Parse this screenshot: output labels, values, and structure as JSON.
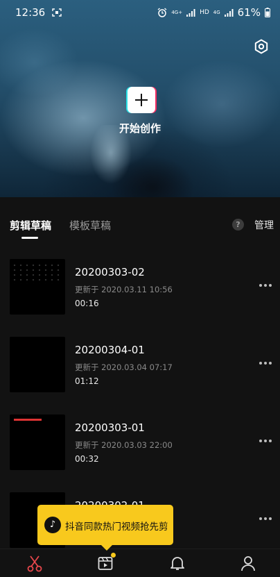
{
  "status_bar": {
    "time": "12:36",
    "network": "4G+",
    "network_hd": "HD",
    "network2": "4G",
    "battery": "61%"
  },
  "hero": {
    "create_label": "开始创作",
    "settings_icon": "gear-icon"
  },
  "tabs": {
    "active": "剪辑草稿",
    "inactive": "模板草稿",
    "help": "?",
    "manage": "管理"
  },
  "drafts": [
    {
      "title": "20200303-02",
      "updated": "更新于 2020.03.11 10:56",
      "duration": "00:16",
      "thumb": "news"
    },
    {
      "title": "20200304-01",
      "updated": "更新于 2020.03.04 07:17",
      "duration": "01:12",
      "thumb": "black"
    },
    {
      "title": "20200303-01",
      "updated": "更新于 2020.03.03 22:00",
      "duration": "00:32",
      "thumb": "game"
    },
    {
      "title": "20200302-01",
      "updated": "",
      "duration": "",
      "thumb": "black"
    }
  ],
  "promo": {
    "text": "抖音同款热门视频抢先剪",
    "icon": "tiktok-icon"
  },
  "nav": {
    "items": [
      {
        "name": "scissors-icon"
      },
      {
        "name": "template-icon"
      },
      {
        "name": "bell-icon"
      },
      {
        "name": "user-icon"
      }
    ],
    "accent": "#e8474c",
    "badge_color": "#f8c91d"
  }
}
